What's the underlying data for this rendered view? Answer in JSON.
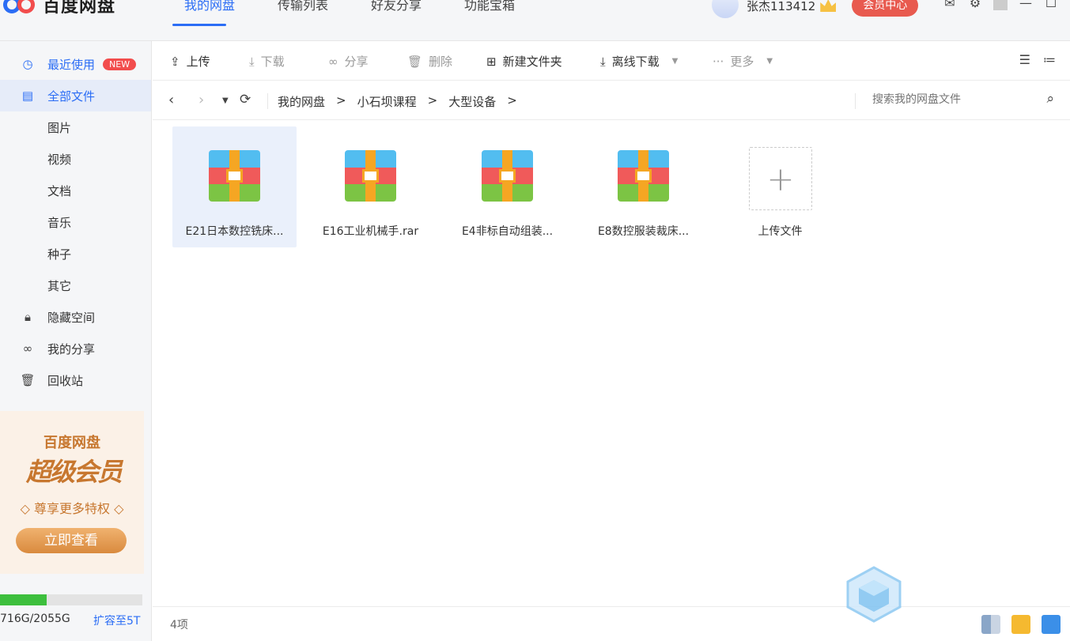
{
  "app": {
    "brand": "百度网盘"
  },
  "topnav": {
    "tabs": [
      "我的网盘",
      "传输列表",
      "好友分享",
      "功能宝箱"
    ],
    "active_tab": "我的网盘",
    "user_name": "张杰113412",
    "vip_button": "会员中心"
  },
  "sidebar": {
    "items": [
      {
        "label": "最近使用",
        "badge": "NEW"
      },
      {
        "label": "全部文件"
      },
      {
        "label": "图片"
      },
      {
        "label": "视频"
      },
      {
        "label": "文档"
      },
      {
        "label": "音乐"
      },
      {
        "label": "种子"
      },
      {
        "label": "其它"
      },
      {
        "label": "隐藏空间"
      },
      {
        "label": "我的分享"
      },
      {
        "label": "回收站"
      }
    ],
    "promo": {
      "line1": "百度网盘",
      "line2": "超级会员",
      "line3": "◇ 尊享更多特权 ◇",
      "button": "立即查看"
    },
    "storage": {
      "text": "716G/2055G",
      "used_fraction": 0.33,
      "expand": "扩容至5T"
    }
  },
  "toolbar": {
    "upload": "上传",
    "download": "下载",
    "share": "分享",
    "delete": "删除",
    "new_folder": "新建文件夹",
    "offline_download": "离线下载",
    "more": "更多"
  },
  "breadcrumb": {
    "items": [
      "我的网盘",
      "小石坝课程",
      "大型设备"
    ],
    "separator": ">",
    "search_placeholder": "搜索我的网盘文件"
  },
  "files": [
    {
      "name": "E21日本数控铣床..."
    },
    {
      "name": "E16工业机械手.rar"
    },
    {
      "name": "E4非标自动组装..."
    },
    {
      "name": "E8数控服装裁床..."
    }
  ],
  "upload_tile": "上传文件",
  "status": {
    "count": "4项"
  }
}
